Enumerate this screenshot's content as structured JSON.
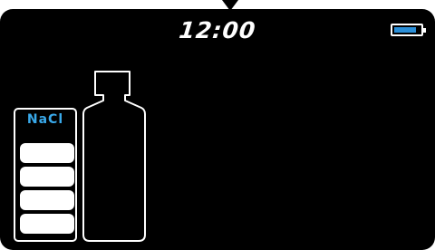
{
  "status_bar": {
    "time": "12:00",
    "battery_level_fraction": 0.85,
    "battery_color": "#2b8fd8",
    "battery_icon": "battery-icon"
  },
  "solution_bag": {
    "label": "NaCl",
    "label_color": "#39a9ea",
    "filled_segments": 4,
    "total_segments": 4
  },
  "container": {
    "icon": "empty-bottle-icon"
  }
}
